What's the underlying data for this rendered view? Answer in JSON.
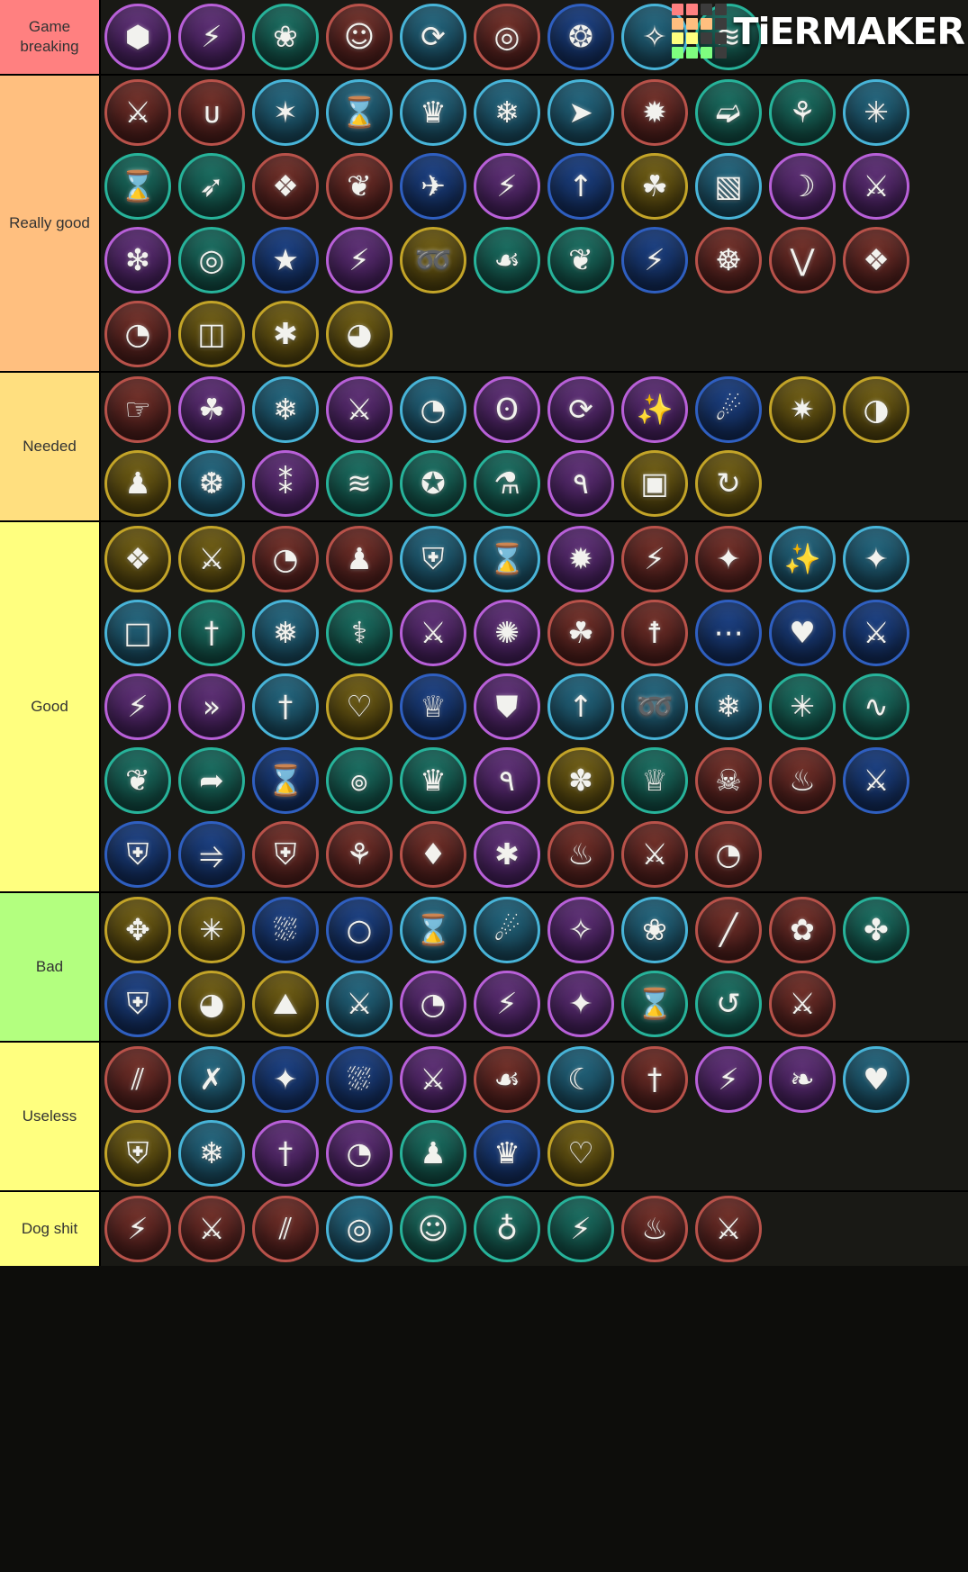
{
  "app": {
    "watermark_text": "TiERMAKER",
    "watermark_grid_colors": [
      "#ff8080",
      "#ff8080",
      "#3c3c3c",
      "#3c3c3c",
      "#ffbf7f",
      "#ffbf7f",
      "#ffbf7f",
      "#3c3c3c",
      "#ffff7f",
      "#ffff7f",
      "#3c3c3c",
      "#3c3c3c",
      "#7fff7f",
      "#7fff7f",
      "#7fff7f",
      "#3c3c3c"
    ]
  },
  "tiers": [
    {
      "label": "Game breaking",
      "color": "#ff8080",
      "items": [
        {
          "name": "gem-orb",
          "family": "purple",
          "glyph": "⬢"
        },
        {
          "name": "lightning-shards",
          "family": "purple",
          "glyph": "⚡"
        },
        {
          "name": "orbit-sparkle",
          "family": "teal",
          "glyph": "❀"
        },
        {
          "name": "ghost",
          "family": "red",
          "glyph": "☺"
        },
        {
          "name": "swirl-vortex",
          "family": "lblue",
          "glyph": "⟳"
        },
        {
          "name": "eye-clock",
          "family": "red",
          "glyph": "◎"
        },
        {
          "name": "planet-sphere",
          "family": "navy",
          "glyph": "❂"
        },
        {
          "name": "crosshair-star",
          "family": "lblue",
          "glyph": "✧"
        },
        {
          "name": "ripple-wave",
          "family": "teal",
          "glyph": "≋"
        }
      ]
    },
    {
      "label": "Really good",
      "color": "#ffbf7f",
      "items": [
        {
          "name": "flame-sword",
          "family": "red",
          "glyph": "⚔"
        },
        {
          "name": "triple-swords",
          "family": "red",
          "glyph": "ᴜ"
        },
        {
          "name": "sparkle-figure",
          "family": "lblue",
          "glyph": "✶"
        },
        {
          "name": "winged-hourglass",
          "family": "lblue",
          "glyph": "⌛"
        },
        {
          "name": "crown-crest",
          "family": "lblue",
          "glyph": "♛"
        },
        {
          "name": "snow-shield",
          "family": "lblue",
          "glyph": "❄"
        },
        {
          "name": "comet-arrow",
          "family": "lblue",
          "glyph": "➤"
        },
        {
          "name": "boulder-burst",
          "family": "red",
          "glyph": "✹"
        },
        {
          "name": "wing-dash",
          "family": "teal",
          "glyph": "➫"
        },
        {
          "name": "wing-crest",
          "family": "teal",
          "glyph": "⚘"
        },
        {
          "name": "aura-plus-one",
          "family": "lblue",
          "glyph": "✳"
        },
        {
          "name": "hourglass",
          "family": "teal",
          "glyph": "⌛"
        },
        {
          "name": "bow-sparkle",
          "family": "teal",
          "glyph": "➶"
        },
        {
          "name": "rock-impact",
          "family": "red",
          "glyph": "❖"
        },
        {
          "name": "squid-figure",
          "family": "red",
          "glyph": "❦"
        },
        {
          "name": "dart-star",
          "family": "navy",
          "glyph": "✈"
        },
        {
          "name": "lightning-cross",
          "family": "purple",
          "glyph": "⚡"
        },
        {
          "name": "trident-up",
          "family": "navy",
          "glyph": "↑"
        },
        {
          "name": "leaf-shield",
          "family": "gold",
          "glyph": "☘"
        },
        {
          "name": "scroll-door",
          "family": "lblue",
          "glyph": "▧"
        },
        {
          "name": "crescent-sparkle",
          "family": "purple",
          "glyph": "☽"
        },
        {
          "name": "sword-slash",
          "family": "purple",
          "glyph": "⚔"
        },
        {
          "name": "ice-spikes",
          "family": "purple",
          "glyph": "❇"
        },
        {
          "name": "target-wing",
          "family": "teal",
          "glyph": "◎"
        },
        {
          "name": "shooting-star",
          "family": "navy",
          "glyph": "★"
        },
        {
          "name": "lightning-bolt",
          "family": "purple",
          "glyph": "⚡"
        },
        {
          "name": "swoosh-gold",
          "family": "gold",
          "glyph": "➿"
        },
        {
          "name": "leaf-shield-green",
          "family": "teal",
          "glyph": "☙"
        },
        {
          "name": "plant-shield",
          "family": "teal",
          "glyph": "❦"
        },
        {
          "name": "triple-bolts",
          "family": "navy",
          "glyph": "⚡"
        },
        {
          "name": "horned-crest",
          "family": "red",
          "glyph": "☸"
        },
        {
          "name": "chevron-stack",
          "family": "red",
          "glyph": "⋁"
        },
        {
          "name": "diamond-weave",
          "family": "red",
          "glyph": "❖"
        },
        {
          "name": "spiral-clock",
          "family": "red",
          "glyph": "◔"
        },
        {
          "name": "double-card",
          "family": "gold",
          "glyph": "◫"
        },
        {
          "name": "spider-dark",
          "family": "gold",
          "glyph": "✱"
        },
        {
          "name": "bug-clock",
          "family": "gold",
          "glyph": "◕"
        }
      ]
    },
    {
      "label": "Needed",
      "color": "#ffdf7f",
      "items": [
        {
          "name": "hand-chevron",
          "family": "red",
          "glyph": "☞"
        },
        {
          "name": "cup-aura",
          "family": "purple",
          "glyph": "☘"
        },
        {
          "name": "snowflake-ring",
          "family": "lblue",
          "glyph": "❄"
        },
        {
          "name": "dual-blades",
          "family": "purple",
          "glyph": "⚔"
        },
        {
          "name": "swirl-clock",
          "family": "lblue",
          "glyph": "◔"
        },
        {
          "name": "horned-eye",
          "family": "purple",
          "glyph": "ʘ"
        },
        {
          "name": "spiral-ring",
          "family": "purple",
          "glyph": "⟳"
        },
        {
          "name": "flame-claw",
          "family": "purple",
          "glyph": "✨"
        },
        {
          "name": "comet-streak",
          "family": "navy",
          "glyph": "☄"
        },
        {
          "name": "burst-gold",
          "family": "gold",
          "glyph": "✷"
        },
        {
          "name": "explosion-clock",
          "family": "gold",
          "glyph": "◑"
        },
        {
          "name": "figure-raise",
          "family": "gold",
          "glyph": "♟"
        },
        {
          "name": "snowflake-clock",
          "family": "lblue",
          "glyph": "❆"
        },
        {
          "name": "cluster-orb",
          "family": "purple",
          "glyph": "⁑"
        },
        {
          "name": "creature-face",
          "family": "teal",
          "glyph": "≋"
        },
        {
          "name": "star-ring",
          "family": "teal",
          "glyph": "✪"
        },
        {
          "name": "cauldron",
          "family": "teal",
          "glyph": "⚗"
        },
        {
          "name": "nine-flame",
          "family": "purple",
          "glyph": "٩"
        },
        {
          "name": "gift-box",
          "family": "gold",
          "glyph": "▣"
        },
        {
          "name": "refresh-cycle",
          "family": "gold",
          "glyph": "↻"
        }
      ]
    },
    {
      "label": "Good",
      "color": "#ffff7f",
      "items": [
        {
          "name": "crystal-spikes",
          "family": "gold",
          "glyph": "❖"
        },
        {
          "name": "sword-impact",
          "family": "gold",
          "glyph": "⚔"
        },
        {
          "name": "bunny-face",
          "family": "red",
          "glyph": "◔"
        },
        {
          "name": "rabbit-doll",
          "family": "red",
          "glyph": "♟"
        },
        {
          "name": "shield-orb",
          "family": "lblue",
          "glyph": "⛨"
        },
        {
          "name": "hourglass-blue",
          "family": "lblue",
          "glyph": "⌛"
        },
        {
          "name": "burst-ring",
          "family": "purple",
          "glyph": "✹"
        },
        {
          "name": "bolt-circle",
          "family": "red",
          "glyph": "⚡"
        },
        {
          "name": "four-point-star",
          "family": "red",
          "glyph": "✦"
        },
        {
          "name": "wand-sparkle",
          "family": "lblue",
          "glyph": "✨"
        },
        {
          "name": "sparkle-cycle",
          "family": "lblue",
          "glyph": "✦"
        },
        {
          "name": "owl-shield",
          "family": "lblue",
          "glyph": "□"
        },
        {
          "name": "sword-sparkle",
          "family": "teal",
          "glyph": "†"
        },
        {
          "name": "snow-chevron",
          "family": "lblue",
          "glyph": "❅"
        },
        {
          "name": "staff-coil",
          "family": "teal",
          "glyph": "⚕"
        },
        {
          "name": "blade-chevron",
          "family": "purple",
          "glyph": "⚔"
        },
        {
          "name": "flame-sparkle",
          "family": "purple",
          "glyph": "✺"
        },
        {
          "name": "clover-leaf",
          "family": "red",
          "glyph": "☘"
        },
        {
          "name": "sword-ring",
          "family": "red",
          "glyph": "☨"
        },
        {
          "name": "dash-lines",
          "family": "navy",
          "glyph": "⋯"
        },
        {
          "name": "heart-shield",
          "family": "navy",
          "glyph": "♥"
        },
        {
          "name": "sword-chevron",
          "family": "navy",
          "glyph": "⚔"
        },
        {
          "name": "bolt-sparkle",
          "family": "purple",
          "glyph": "⚡"
        },
        {
          "name": "double-chevron-shield",
          "family": "purple",
          "glyph": "»"
        },
        {
          "name": "dagger-chevron",
          "family": "lblue",
          "glyph": "†"
        },
        {
          "name": "heart-ring",
          "family": "gold",
          "glyph": "♡"
        },
        {
          "name": "winged-crest",
          "family": "navy",
          "glyph": "♕"
        },
        {
          "name": "shield-drop",
          "family": "purple",
          "glyph": "⛊"
        },
        {
          "name": "spear-up",
          "family": "lblue",
          "glyph": "↑"
        },
        {
          "name": "feather-dash",
          "family": "lblue",
          "glyph": "➿"
        },
        {
          "name": "horn-snow",
          "family": "lblue",
          "glyph": "❄"
        },
        {
          "name": "star-arrows",
          "family": "teal",
          "glyph": "✳"
        },
        {
          "name": "wave-chevron",
          "family": "teal",
          "glyph": "∿"
        },
        {
          "name": "snail-shell",
          "family": "teal",
          "glyph": "❦"
        },
        {
          "name": "swoop-dash",
          "family": "teal",
          "glyph": "➦"
        },
        {
          "name": "hourglass-wide",
          "family": "navy",
          "glyph": "⌛"
        },
        {
          "name": "spiral-galaxy",
          "family": "teal",
          "glyph": "๏"
        },
        {
          "name": "crown-wing",
          "family": "teal",
          "glyph": "♛"
        },
        {
          "name": "nine-slash",
          "family": "purple",
          "glyph": "٩"
        },
        {
          "name": "burst-gold-dark",
          "family": "gold",
          "glyph": "✽"
        },
        {
          "name": "crown-feather",
          "family": "teal",
          "glyph": "♕"
        },
        {
          "name": "horned-skull",
          "family": "red",
          "glyph": "☠"
        },
        {
          "name": "flame-horn",
          "family": "red",
          "glyph": "♨"
        },
        {
          "name": "blade-blue",
          "family": "navy",
          "glyph": "⚔"
        },
        {
          "name": "shield-plain",
          "family": "navy",
          "glyph": "⛨"
        },
        {
          "name": "arrows-row",
          "family": "navy",
          "glyph": "⥤"
        },
        {
          "name": "shield-red",
          "family": "red",
          "glyph": "⛨"
        },
        {
          "name": "figure-arms",
          "family": "red",
          "glyph": "⚘"
        },
        {
          "name": "gem-heart",
          "family": "red",
          "glyph": "♦"
        },
        {
          "name": "rpg-letters",
          "family": "purple",
          "glyph": "✱"
        },
        {
          "name": "flame-burst",
          "family": "red",
          "glyph": "♨"
        },
        {
          "name": "sword-diagonal",
          "family": "red",
          "glyph": "⚔"
        },
        {
          "name": "orb-clock",
          "family": "red",
          "glyph": "◔"
        }
      ]
    },
    {
      "label": "Bad",
      "color": "#b3ff7f",
      "items": [
        {
          "name": "compass-flower",
          "family": "gold",
          "glyph": "✥"
        },
        {
          "name": "figure-wings",
          "family": "gold",
          "glyph": "✳"
        },
        {
          "name": "water-drops",
          "family": "navy",
          "glyph": "⛆"
        },
        {
          "name": "angel-orb",
          "family": "navy",
          "glyph": "○"
        },
        {
          "name": "hourglass-lblue",
          "family": "lblue",
          "glyph": "⌛"
        },
        {
          "name": "meteor-wing",
          "family": "lblue",
          "glyph": "☄"
        },
        {
          "name": "wing-bolt",
          "family": "purple",
          "glyph": "✧"
        },
        {
          "name": "lotus-flower",
          "family": "lblue",
          "glyph": "❀"
        },
        {
          "name": "claw-slash",
          "family": "red",
          "glyph": "╱"
        },
        {
          "name": "cherry-blossom",
          "family": "red",
          "glyph": "✿"
        },
        {
          "name": "crest-shield",
          "family": "teal",
          "glyph": "✤"
        },
        {
          "name": "slash-shield",
          "family": "navy",
          "glyph": "⛨"
        },
        {
          "name": "cart-clock",
          "family": "gold",
          "glyph": "◕"
        },
        {
          "name": "mountain-burst",
          "family": "gold",
          "glyph": "⛰"
        },
        {
          "name": "sword-scroll",
          "family": "lblue",
          "glyph": "⚔"
        },
        {
          "name": "star-clock",
          "family": "purple",
          "glyph": "◔"
        },
        {
          "name": "lightning-pair",
          "family": "purple",
          "glyph": "⚡"
        },
        {
          "name": "four-star",
          "family": "purple",
          "glyph": "✦"
        },
        {
          "name": "hourglass-teal",
          "family": "teal",
          "glyph": "⌛"
        },
        {
          "name": "star-arrow-loop",
          "family": "teal",
          "glyph": "↺"
        },
        {
          "name": "crossed-blades",
          "family": "red",
          "glyph": "⚔"
        }
      ]
    },
    {
      "label": "Useless",
      "color": "#ffff7f",
      "items": [
        {
          "name": "claw-strike",
          "family": "red",
          "glyph": "⫽"
        },
        {
          "name": "bow-cross",
          "family": "lblue",
          "glyph": "✗"
        },
        {
          "name": "star-swirl",
          "family": "navy",
          "glyph": "✦"
        },
        {
          "name": "droplet-shield",
          "family": "navy",
          "glyph": "⛆"
        },
        {
          "name": "sword-bolt",
          "family": "purple",
          "glyph": "⚔"
        },
        {
          "name": "hook-curve",
          "family": "red",
          "glyph": "☙"
        },
        {
          "name": "crescent-swoosh",
          "family": "lblue",
          "glyph": "☾"
        },
        {
          "name": "winged-sword",
          "family": "red",
          "glyph": "†"
        },
        {
          "name": "bolt-square",
          "family": "purple",
          "glyph": "⚡"
        },
        {
          "name": "wing-flare",
          "family": "purple",
          "glyph": "❧"
        },
        {
          "name": "heart-shield-blue",
          "family": "lblue",
          "glyph": "♥"
        },
        {
          "name": "shield-gold",
          "family": "gold",
          "glyph": "⛨"
        },
        {
          "name": "snow-crest",
          "family": "lblue",
          "glyph": "❄"
        },
        {
          "name": "cross-sword",
          "family": "purple",
          "glyph": "†"
        },
        {
          "name": "orb-clock-purple",
          "family": "purple",
          "glyph": "◔"
        },
        {
          "name": "figure-meditate",
          "family": "teal",
          "glyph": "♟"
        },
        {
          "name": "crown-eye",
          "family": "navy",
          "glyph": "♛"
        },
        {
          "name": "shield-heart-gold",
          "family": "gold",
          "glyph": "♡"
        }
      ]
    },
    {
      "label": "Dog shit",
      "color": "#ffff7f",
      "items": [
        {
          "name": "lightning-claw",
          "family": "red",
          "glyph": "⚡"
        },
        {
          "name": "flame-sword-red",
          "family": "red",
          "glyph": "⚔"
        },
        {
          "name": "slash-trio",
          "family": "red",
          "glyph": "⫽"
        },
        {
          "name": "target-clock",
          "family": "lblue",
          "glyph": "◎"
        },
        {
          "name": "figure-halo",
          "family": "teal",
          "glyph": "☺"
        },
        {
          "name": "planet-ring",
          "family": "teal",
          "glyph": "♁"
        },
        {
          "name": "bolt-small",
          "family": "teal",
          "glyph": "⚡"
        },
        {
          "name": "flame-spiral",
          "family": "red",
          "glyph": "♨"
        },
        {
          "name": "sword-chevron-red",
          "family": "red",
          "glyph": "⚔"
        }
      ]
    }
  ]
}
